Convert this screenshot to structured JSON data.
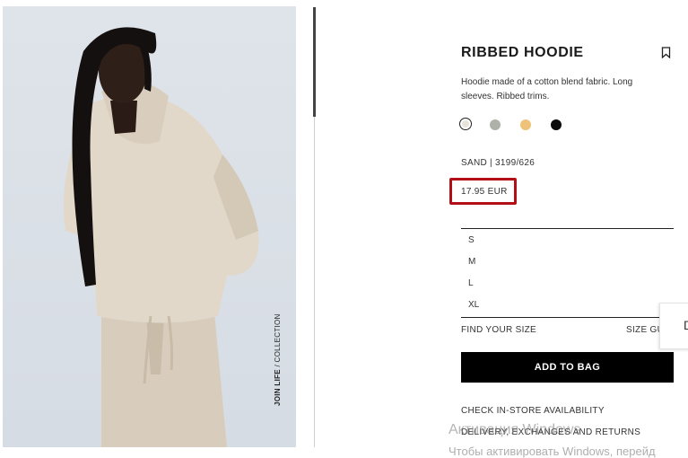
{
  "photo": {
    "caption_bold": "JOIN LIFE",
    "caption_rest": " / COLLECTION"
  },
  "product": {
    "title": "RIBBED HOODIE",
    "description": "Hoodie made of a cotton blend fabric. Long sleeves. Ribbed trims.",
    "colors": [
      {
        "name": "sand",
        "hex": "#e9e4da",
        "selected": true
      },
      {
        "name": "grey",
        "hex": "#aeb1a8",
        "selected": false
      },
      {
        "name": "mustard",
        "hex": "#eec278",
        "selected": false
      },
      {
        "name": "black",
        "hex": "#0b0b0b",
        "selected": false
      }
    ],
    "reference": "SAND | 3199/626",
    "price": "17.95 EUR",
    "sizes": [
      "S",
      "M",
      "L",
      "XL"
    ],
    "find_your_size": "FIND YOUR SIZE",
    "size_guide": "SIZE GUIDE",
    "add_to_bag": "ADD TO BAG",
    "check_store": "CHECK IN-STORE AVAILABILITY",
    "delivery": "DELIVERY, EXCHANGES AND RETURNS"
  },
  "side_widget": {
    "label": "D"
  },
  "watermark": {
    "line1": "Активация Windows",
    "line2": "Чтобы активировать Windows, перейд"
  },
  "highlight_color": "#b30f16"
}
